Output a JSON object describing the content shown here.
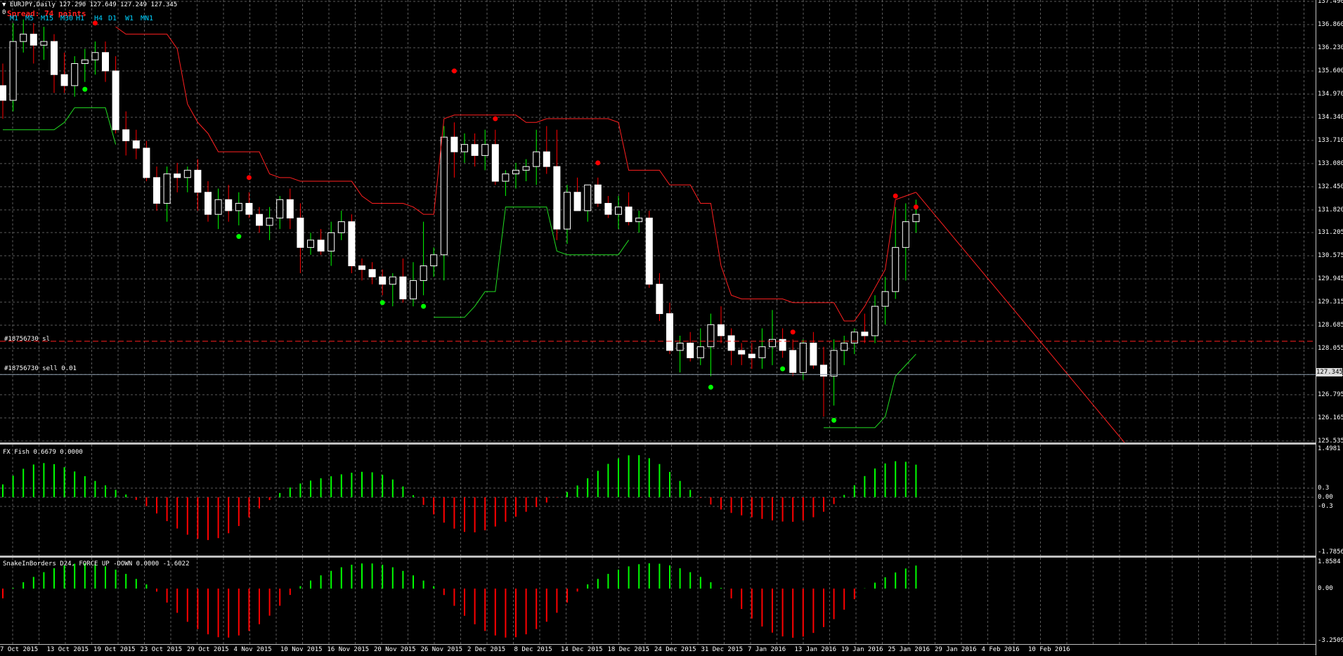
{
  "header": {
    "symbol_line": "EURJPY,Daily  127.290 127.649 127.249 127.345",
    "zero_label": "0",
    "spread_text": "Spread: 74 points",
    "timeframes": [
      "M1",
      "M5",
      "M15",
      "M30",
      "H1",
      "H4",
      "D1",
      "W1",
      "MN1"
    ]
  },
  "trade_lines": {
    "sl_label": "#18756730 sl",
    "sell_label": "#18756730 sell 0.01",
    "current_price": "127.345"
  },
  "main_axis": {
    "ticks": [
      "137.490",
      "136.860",
      "136.230",
      "135.600",
      "134.970",
      "134.340",
      "133.710",
      "133.080",
      "132.450",
      "131.820",
      "131.205",
      "130.575",
      "129.945",
      "129.315",
      "128.685",
      "128.055",
      "127.345",
      "126.795",
      "126.165",
      "125.535"
    ]
  },
  "fish": {
    "title": "FX Fish 0.6679 0.0000",
    "ticks": [
      "1.4981",
      "0.3",
      "0.00",
      "-0.3",
      "-1.7856"
    ]
  },
  "snake": {
    "title": "SnakeInBorders D24, FORCE UP -DOWN  0.0000 -1.6022",
    "ticks": [
      "1.8584",
      "0.00",
      "-3.2509"
    ]
  },
  "x_axis": {
    "labels": [
      "7 Oct 2015",
      "13 Oct 2015",
      "19 Oct 2015",
      "23 Oct 2015",
      "29 Oct 2015",
      "4 Nov 2015",
      "10 Nov 2015",
      "16 Nov 2015",
      "20 Nov 2015",
      "26 Nov 2015",
      "2 Dec 2015",
      "8 Dec 2015",
      "14 Dec 2015",
      "18 Dec 2015",
      "24 Dec 2015",
      "31 Dec 2015",
      "7 Jan 2016",
      "13 Jan 2016",
      "19 Jan 2016",
      "25 Jan 2016",
      "29 Jan 2016",
      "4 Feb 2016",
      "10 Feb 2016"
    ]
  },
  "colors": {
    "bull": "#00ff00",
    "bear": "#ff0000",
    "candle_body": "#ffffff",
    "grid": "#5a5a5a",
    "red_trail": "#ff2020",
    "green_trail": "#22dd22"
  },
  "chart_data": {
    "type": "candlestick",
    "symbol": "EURJPY",
    "timeframe": "Daily",
    "ylim": [
      125.535,
      137.49
    ],
    "dates": [
      "7 Oct 2015",
      "8 Oct 2015",
      "9 Oct 2015",
      "12 Oct 2015",
      "13 Oct 2015",
      "14 Oct 2015",
      "15 Oct 2015",
      "16 Oct 2015",
      "19 Oct 2015",
      "20 Oct 2015",
      "21 Oct 2015",
      "22 Oct 2015",
      "23 Oct 2015",
      "26 Oct 2015",
      "27 Oct 2015",
      "28 Oct 2015",
      "29 Oct 2015",
      "30 Oct 2015",
      "2 Nov 2015",
      "3 Nov 2015",
      "4 Nov 2015",
      "5 Nov 2015",
      "6 Nov 2015",
      "9 Nov 2015",
      "10 Nov 2015",
      "11 Nov 2015",
      "12 Nov 2015",
      "13 Nov 2015",
      "16 Nov 2015",
      "17 Nov 2015",
      "18 Nov 2015",
      "19 Nov 2015",
      "20 Nov 2015",
      "23 Nov 2015",
      "24 Nov 2015",
      "25 Nov 2015",
      "26 Nov 2015",
      "27 Nov 2015",
      "30 Nov 2015",
      "1 Dec 2015",
      "2 Dec 2015",
      "3 Dec 2015",
      "4 Dec 2015",
      "7 Dec 2015",
      "8 Dec 2015",
      "9 Dec 2015",
      "10 Dec 2015",
      "11 Dec 2015",
      "14 Dec 2015",
      "15 Dec 2015",
      "16 Dec 2015",
      "17 Dec 2015",
      "18 Dec 2015",
      "21 Dec 2015",
      "22 Dec 2015",
      "23 Dec 2015",
      "24 Dec 2015",
      "25 Dec 2015",
      "28 Dec 2015",
      "29 Dec 2015",
      "30 Dec 2015",
      "31 Dec 2015",
      "1 Jan 2016",
      "4 Jan 2016",
      "5 Jan 2016",
      "6 Jan 2016",
      "7 Jan 2016",
      "8 Jan 2016",
      "11 Jan 2016",
      "12 Jan 2016",
      "13 Jan 2016",
      "14 Jan 2016",
      "15 Jan 2016",
      "18 Jan 2016",
      "19 Jan 2016",
      "20 Jan 2016",
      "21 Jan 2016",
      "22 Jan 2016",
      "25 Jan 2016",
      "26 Jan 2016",
      "27 Jan 2016",
      "28 Jan 2016",
      "29 Jan 2016",
      "1 Feb 2016",
      "2 Feb 2016",
      "3 Feb 2016",
      "4 Feb 2016",
      "5 Feb 2016",
      "8 Feb 2016",
      "9 Feb 2016",
      "10 Feb 2016",
      "11 Feb 2016",
      "12 Feb 2016",
      "15 Feb 2016"
    ],
    "ohlc": [
      [
        135.2,
        135.8,
        134.3,
        134.8
      ],
      [
        134.8,
        136.9,
        134.5,
        136.4
      ],
      [
        136.4,
        137.0,
        136.1,
        136.6
      ],
      [
        136.6,
        136.9,
        135.8,
        136.3
      ],
      [
        136.3,
        136.8,
        135.9,
        136.4
      ],
      [
        136.4,
        136.6,
        135.0,
        135.5
      ],
      [
        135.5,
        136.1,
        135.0,
        135.2
      ],
      [
        135.2,
        136.0,
        134.9,
        135.8
      ],
      [
        135.8,
        136.2,
        135.3,
        135.9
      ],
      [
        135.9,
        136.4,
        135.5,
        136.1
      ],
      [
        136.1,
        136.4,
        135.3,
        135.6
      ],
      [
        135.6,
        136.0,
        133.9,
        134.0
      ],
      [
        134.0,
        134.5,
        133.3,
        133.7
      ],
      [
        133.7,
        134.0,
        133.2,
        133.5
      ],
      [
        133.5,
        133.7,
        132.6,
        132.7
      ],
      [
        132.7,
        133.0,
        131.8,
        132.0
      ],
      [
        132.0,
        133.0,
        131.5,
        132.8
      ],
      [
        132.8,
        133.1,
        132.3,
        132.7
      ],
      [
        132.7,
        133.0,
        132.3,
        132.9
      ],
      [
        132.9,
        133.2,
        131.8,
        132.3
      ],
      [
        132.3,
        132.6,
        131.5,
        131.7
      ],
      [
        131.7,
        132.4,
        131.3,
        132.1
      ],
      [
        132.1,
        132.5,
        131.5,
        131.8
      ],
      [
        131.8,
        132.3,
        131.4,
        132.0
      ],
      [
        132.0,
        132.3,
        131.6,
        131.7
      ],
      [
        131.7,
        131.9,
        131.2,
        131.4
      ],
      [
        131.4,
        131.9,
        131.0,
        131.6
      ],
      [
        131.6,
        132.2,
        131.3,
        132.1
      ],
      [
        132.1,
        132.4,
        131.3,
        131.6
      ],
      [
        131.6,
        132.0,
        130.1,
        130.8
      ],
      [
        130.8,
        131.2,
        130.6,
        131.0
      ],
      [
        131.0,
        131.3,
        130.6,
        130.7
      ],
      [
        130.7,
        131.5,
        130.3,
        131.2
      ],
      [
        131.2,
        131.8,
        131.0,
        131.5
      ],
      [
        131.5,
        131.7,
        130.1,
        130.3
      ],
      [
        130.3,
        130.5,
        129.9,
        130.2
      ],
      [
        130.2,
        130.4,
        129.8,
        130.0
      ],
      [
        130.0,
        130.2,
        129.5,
        129.8
      ],
      [
        129.8,
        130.1,
        129.2,
        130.0
      ],
      [
        130.0,
        130.5,
        129.3,
        129.4
      ],
      [
        129.4,
        130.4,
        129.2,
        129.9
      ],
      [
        129.9,
        131.5,
        129.5,
        130.3
      ],
      [
        130.3,
        130.8,
        130.0,
        130.6
      ],
      [
        130.6,
        134.1,
        129.9,
        133.8
      ],
      [
        133.8,
        134.2,
        132.7,
        133.4
      ],
      [
        133.4,
        133.9,
        133.1,
        133.6
      ],
      [
        133.6,
        133.9,
        133.0,
        133.3
      ],
      [
        133.3,
        134.0,
        132.9,
        133.6
      ],
      [
        133.6,
        134.0,
        132.5,
        132.6
      ],
      [
        132.6,
        132.9,
        132.2,
        132.8
      ],
      [
        132.8,
        133.1,
        132.4,
        132.9
      ],
      [
        132.9,
        133.2,
        132.6,
        133.0
      ],
      [
        133.0,
        134.0,
        132.5,
        133.4
      ],
      [
        133.4,
        134.1,
        132.8,
        133.0
      ],
      [
        133.0,
        134.0,
        131.0,
        131.3
      ],
      [
        131.3,
        132.5,
        130.9,
        132.3
      ],
      [
        132.3,
        132.7,
        131.8,
        131.8
      ],
      [
        131.8,
        132.4,
        131.5,
        132.5
      ],
      [
        132.5,
        132.7,
        131.9,
        132.0
      ],
      [
        132.0,
        132.2,
        131.6,
        131.7
      ],
      [
        131.7,
        132.2,
        131.3,
        131.9
      ],
      [
        131.9,
        132.3,
        131.4,
        131.5
      ],
      [
        131.5,
        131.8,
        131.2,
        131.6
      ],
      [
        131.6,
        131.8,
        129.7,
        129.8
      ],
      [
        129.8,
        130.1,
        128.8,
        129.0
      ],
      [
        129.0,
        129.3,
        127.9,
        128.0
      ],
      [
        128.0,
        128.4,
        127.4,
        128.2
      ],
      [
        128.2,
        128.5,
        127.7,
        127.8
      ],
      [
        127.8,
        128.6,
        127.6,
        128.1
      ],
      [
        128.1,
        129.0,
        127.3,
        128.7
      ],
      [
        128.7,
        129.2,
        128.2,
        128.4
      ],
      [
        128.4,
        128.6,
        127.6,
        128.0
      ],
      [
        128.0,
        128.2,
        127.6,
        127.9
      ],
      [
        127.9,
        128.2,
        127.5,
        127.8
      ],
      [
        127.8,
        128.6,
        127.5,
        128.1
      ],
      [
        128.1,
        129.1,
        127.6,
        128.3
      ],
      [
        128.3,
        128.6,
        127.8,
        128.0
      ],
      [
        128.0,
        128.3,
        127.3,
        127.4
      ],
      [
        127.4,
        128.3,
        127.2,
        128.2
      ],
      [
        128.2,
        128.5,
        127.5,
        127.6
      ],
      [
        127.6,
        128.1,
        126.2,
        127.3
      ],
      [
        127.3,
        128.3,
        126.5,
        128.0
      ],
      [
        128.0,
        128.4,
        127.6,
        128.2
      ],
      [
        128.2,
        128.6,
        127.9,
        128.5
      ],
      [
        128.5,
        129.0,
        128.2,
        128.4
      ],
      [
        128.4,
        129.5,
        128.2,
        129.2
      ],
      [
        129.2,
        130.0,
        128.7,
        129.6
      ],
      [
        129.6,
        131.9,
        129.4,
        130.8
      ],
      [
        130.8,
        132.0,
        129.9,
        131.5
      ],
      [
        131.5,
        132.1,
        131.2,
        131.7
      ]
    ]
  }
}
